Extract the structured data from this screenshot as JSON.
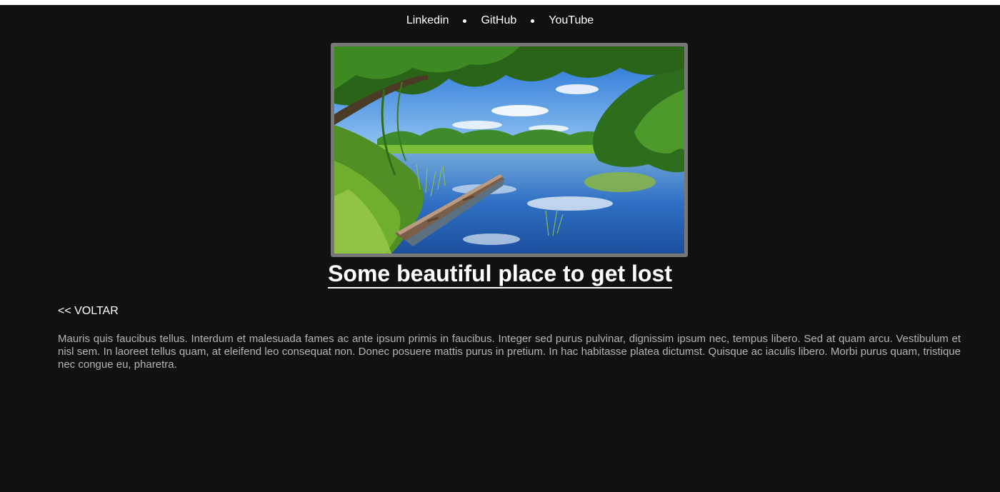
{
  "nav": {
    "links": [
      "Linkedin",
      "GitHub",
      "YouTube"
    ]
  },
  "hero": {
    "alt": "Some beautiful place to get lost"
  },
  "article": {
    "title": "Some beautiful place to get lost",
    "back_label": "<< VOLTAR",
    "body": "Mauris quis faucibus tellus. Interdum et malesuada fames ac ante ipsum primis in faucibus. Integer sed purus pulvinar, dignissim ipsum nec, tempus libero. Sed at quam arcu. Vestibulum et nisl sem. In laoreet tellus quam, at eleifend leo consequat non. Donec posuere mattis purus in pretium. In hac habitasse platea dictumst. Quisque ac iaculis libero. Morbi purus quam, tristique nec congue eu, pharetra."
  },
  "colors": {
    "background": "#111111",
    "text": "#ffffff",
    "body_text": "#b4b4b4",
    "image_border": "#777777"
  }
}
